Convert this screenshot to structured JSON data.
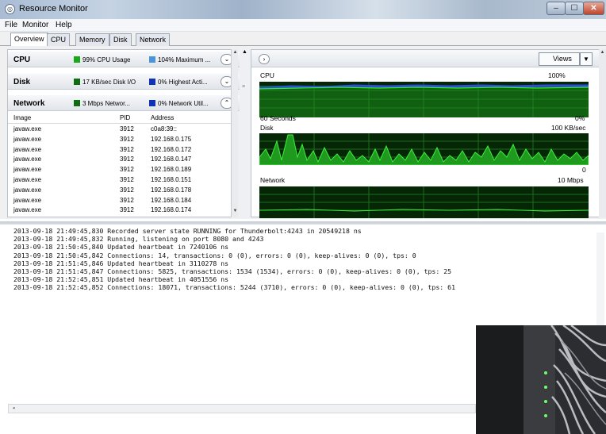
{
  "window": {
    "title": "Resource Monitor",
    "controls": {
      "minimize": "‒",
      "maximize": "☐",
      "close": "✕"
    }
  },
  "menu": [
    "File",
    "Monitor",
    "Help"
  ],
  "tabs": [
    "Overview",
    "CPU",
    "Memory",
    "Disk",
    "Network"
  ],
  "sections": {
    "cpu": {
      "title": "CPU",
      "metric1": "99% CPU Usage",
      "metric2": "104% Maximum ...",
      "chevron": "⌄"
    },
    "disk": {
      "title": "Disk",
      "metric1": "17 KB/sec Disk I/O",
      "metric2": "0% Highest Acti...",
      "chevron": "⌄"
    },
    "network": {
      "title": "Network",
      "metric1": "3 Mbps Networ...",
      "metric2": "0% Network Util...",
      "chevron": "⌃"
    }
  },
  "network_table": {
    "headers": {
      "image": "Image",
      "pid": "PID",
      "address": "Address"
    },
    "rows": [
      {
        "image": "javaw.exe",
        "pid": "3912",
        "address": "c0a8:39::"
      },
      {
        "image": "javaw.exe",
        "pid": "3912",
        "address": "192.168.0.175"
      },
      {
        "image": "javaw.exe",
        "pid": "3912",
        "address": "192.168.0.172"
      },
      {
        "image": "javaw.exe",
        "pid": "3912",
        "address": "192.168.0.147"
      },
      {
        "image": "javaw.exe",
        "pid": "3912",
        "address": "192.168.0.189"
      },
      {
        "image": "javaw.exe",
        "pid": "3912",
        "address": "192.168.0.151"
      },
      {
        "image": "javaw.exe",
        "pid": "3912",
        "address": "192.168.0.178"
      },
      {
        "image": "javaw.exe",
        "pid": "3912",
        "address": "192.168.0.184"
      },
      {
        "image": "javaw.exe",
        "pid": "3912",
        "address": "192.168.0.174"
      }
    ]
  },
  "graphs": {
    "views_label": "Views",
    "cpu": {
      "title": "CPU",
      "max": "100%",
      "min": "0%",
      "window": "60 Seconds"
    },
    "disk": {
      "title": "Disk",
      "max": "100 KB/sec",
      "min": "0"
    },
    "network": {
      "title": "Network",
      "max": "10 Mbps"
    }
  },
  "console": {
    "lines": [
      "2013-09-18 21:49:45,830 Recorded server state RUNNING for Thunderbolt:4243 in 20549218 ns",
      "2013-09-18 21:49:45,832 Running, listening on port 8080 and 4243",
      "2013-09-18 21:50:45,840 Updated heartbeat in 7240106 ns",
      "2013-09-18 21:50:45,842 Connections: 14, transactions: 0 (0), errors: 0 (0), keep-alives: 0 (0), tps: 0",
      "2013-09-18 21:51:45,846 Updated heartbeat in 3110278 ns",
      "2013-09-18 21:51:45,847 Connections: 5825, transactions: 1534 (1534), errors: 0 (0), keep-alives: 0 (0), tps: 25",
      "2013-09-18 21:52:45,851 Updated heartbeat in 4051556 ns",
      "2013-09-18 21:52:45,852 Connections: 18071, transactions: 5244 (3710), errors: 0 (0), keep-alives: 0 (0), tps: 61"
    ]
  },
  "colors": {
    "graph_bg": "#052705",
    "graph_line": "#2fe12f",
    "graph_grid": "#1e6b1e",
    "cpu_blue": "#2b4fd6"
  }
}
